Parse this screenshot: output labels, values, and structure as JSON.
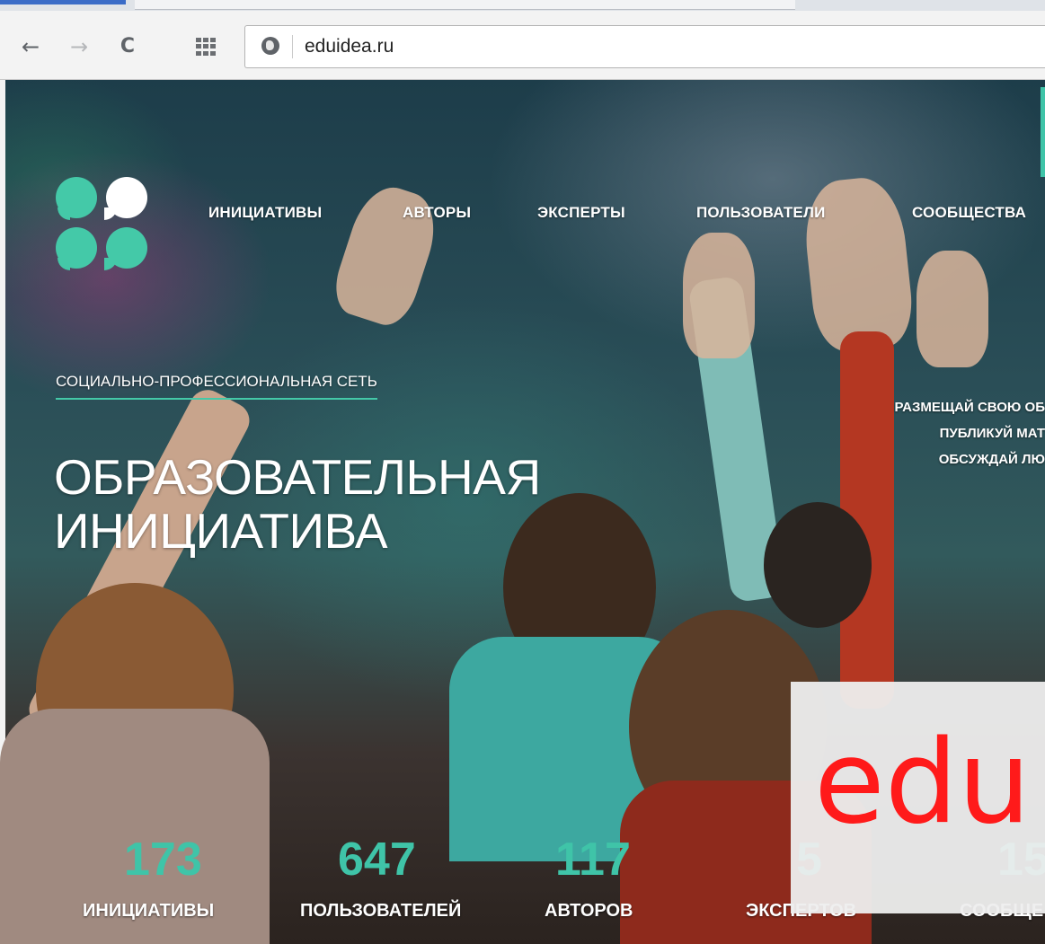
{
  "browser": {
    "url": "eduidea.ru",
    "back_icon": "arrow-left-icon",
    "forward_icon": "arrow-right-icon",
    "reload_icon": "reload-icon",
    "apps_icon": "apps-grid-icon",
    "site_icon": "globe-icon"
  },
  "nav": {
    "items": [
      "ИНИЦИАТИВЫ",
      "АВТОРЫ",
      "ЭКСПЕРТЫ",
      "ПОЛЬЗОВАТЕЛИ",
      "СООБЩЕСТВА"
    ]
  },
  "hero": {
    "tagline": "СОЦИАЛЬНО-ПРОФЕССИОНАЛЬНАЯ СЕТЬ",
    "title_line1": "ОБРАЗОВАТЕЛЬНАЯ",
    "title_line2": "ИНИЦИАТИВА",
    "right_lines": [
      "РАЗМЕЩАЙ СВОЮ ОБ",
      "ПУБЛИКУЙ МАТ",
      "ОБСУЖДАЙ ЛЮ"
    ]
  },
  "stats": [
    {
      "value": "173",
      "label": "ИНИЦИАТИВЫ"
    },
    {
      "value": "647",
      "label": "ПОЛЬЗОВАТЕЛЕЙ"
    },
    {
      "value": "117",
      "label": "АВТОРОВ"
    },
    {
      "value": "5",
      "label": "ЭКСПЕРТОВ"
    },
    {
      "value": "15",
      "label": "СООБЩЕ"
    }
  ],
  "overlay": {
    "text": "edu"
  },
  "colors": {
    "accent": "#3fc4a8",
    "overlay_text": "#ff1a1a"
  }
}
